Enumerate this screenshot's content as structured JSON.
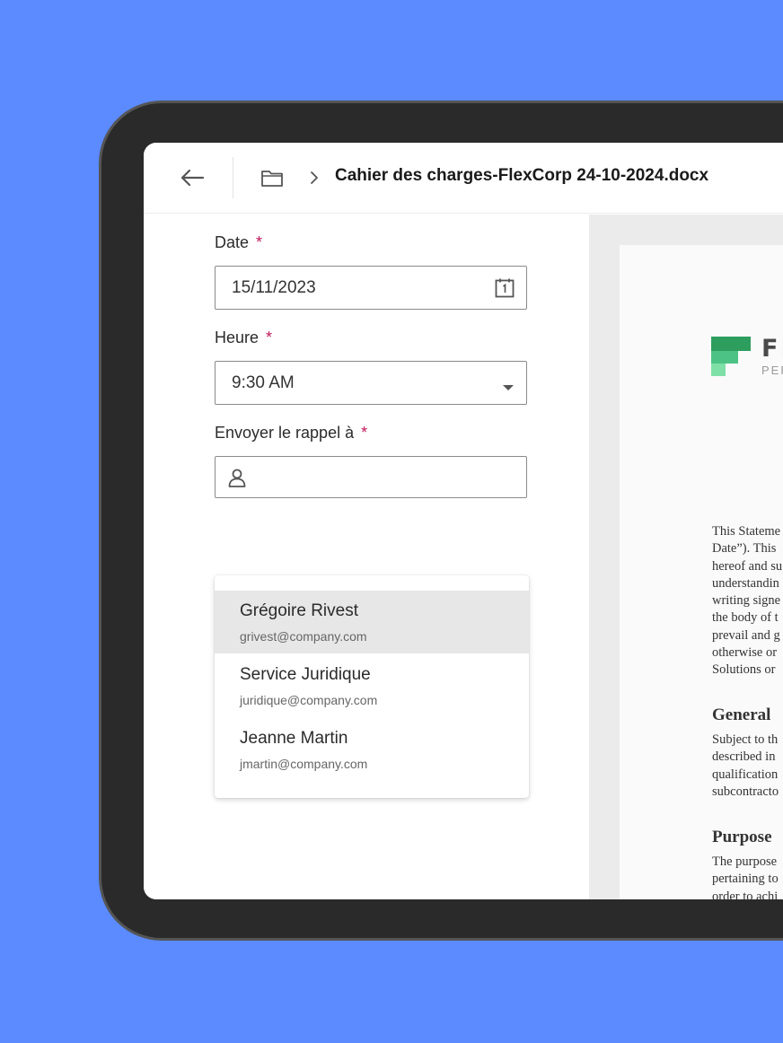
{
  "header": {
    "title": "Cahier des charges-FlexCorp 24-10-2024.docx",
    "back_icon": "arrow-left-icon",
    "folder_icon": "folder-icon",
    "separator_icon": "chevron-right-icon"
  },
  "form": {
    "date": {
      "label": "Date",
      "required_mark": "*",
      "value": "15/11/2023",
      "icon": "calendar-icon"
    },
    "time": {
      "label": "Heure",
      "required_mark": "*",
      "value": "9:30 AM",
      "icon": "caret-down-icon"
    },
    "reminder": {
      "label": "Envoyer le rappel à",
      "required_mark": "*",
      "value": "",
      "icon": "user-icon"
    }
  },
  "dropdown": {
    "items": [
      {
        "name": "Grégoire Rivest",
        "email": "grivest@company.com",
        "highlighted": true
      },
      {
        "name": "Service Juridique",
        "email": "juridique@company.com",
        "highlighted": false
      },
      {
        "name": "Jeanne Martin",
        "email": "jmartin@company.com",
        "highlighted": false
      }
    ]
  },
  "preview": {
    "logo_text": "FI",
    "logo_sub": "PER",
    "intro_lines": [
      "This Stateme",
      "Date”). This",
      "hereof and su",
      "understandin",
      "writing signe",
      "the body of t",
      "prevail and g",
      "otherwise or",
      "Solutions or"
    ],
    "general_heading": "General",
    "general_lines": [
      "Subject to th",
      "described in",
      "qualification",
      "subcontracto"
    ],
    "purpose_heading": "Purpose",
    "purpose_lines": [
      "The purpose",
      "pertaining to",
      "order to achi"
    ]
  },
  "colors": {
    "background": "#5b8bff",
    "required": "#c2185b",
    "logo_dark": "#2e9e5f",
    "logo_light": "#7ee0a6"
  }
}
